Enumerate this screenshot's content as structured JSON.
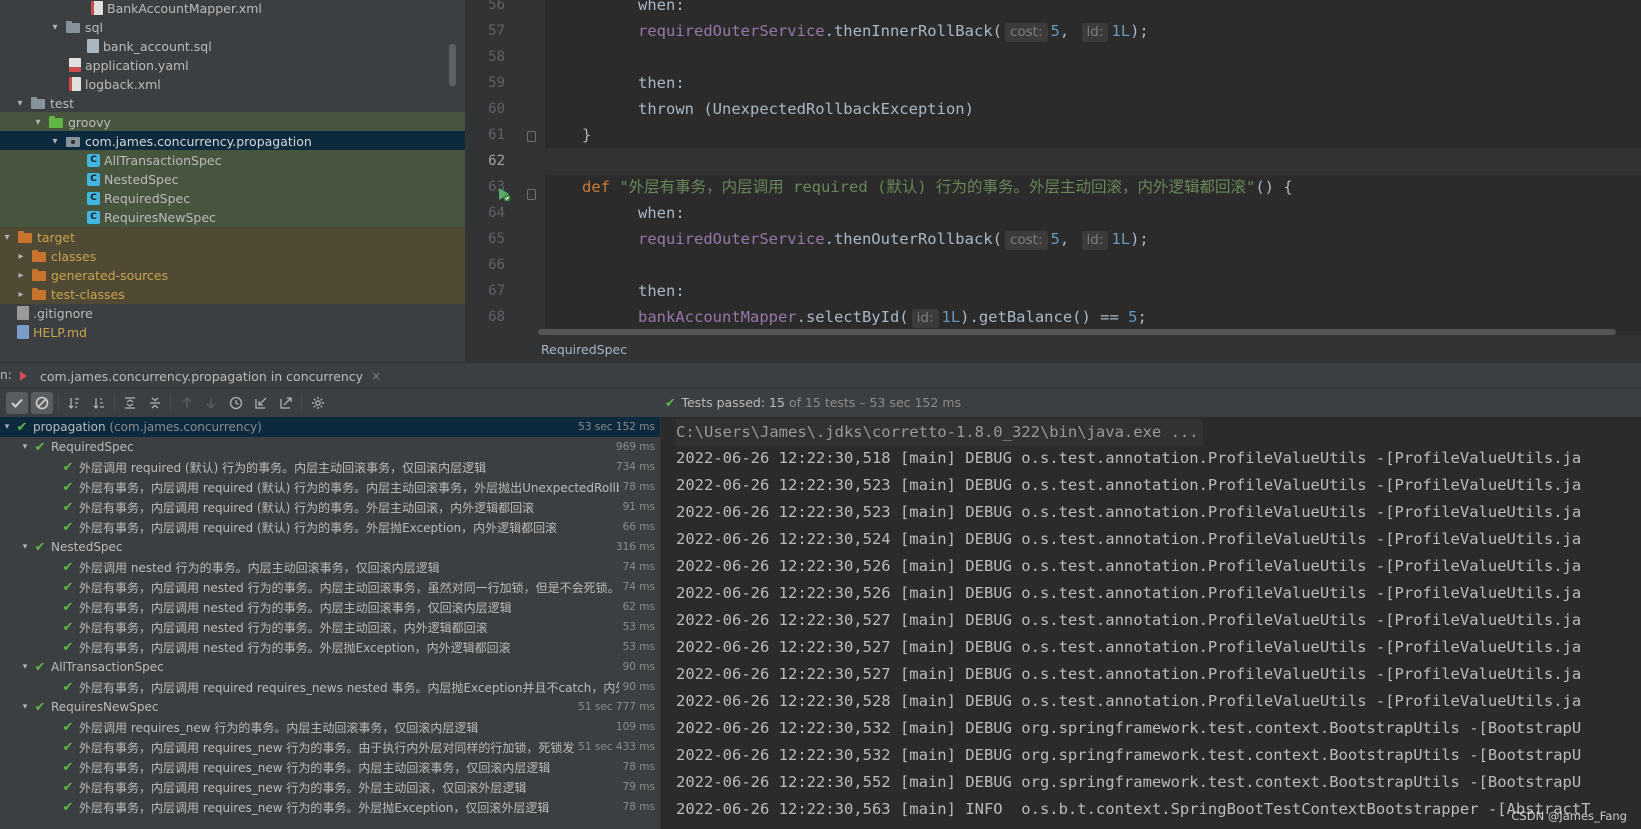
{
  "project_tree": {
    "items": [
      {
        "label": "BankAccountMapper.xml",
        "icon": "xml-file-icon",
        "state": ""
      },
      {
        "label": "sql",
        "icon": "folder-icon",
        "state": "expanded"
      },
      {
        "label": "bank_account.sql",
        "icon": "sql-file-icon",
        "state": ""
      },
      {
        "label": "application.yaml",
        "icon": "yaml-file-icon",
        "state": ""
      },
      {
        "label": "logback.xml",
        "icon": "xml-file-icon",
        "state": ""
      },
      {
        "label": "test",
        "icon": "folder-icon",
        "state": "expanded"
      },
      {
        "label": "groovy",
        "icon": "test-root-folder-icon",
        "state": "expanded"
      },
      {
        "label": "com.james.concurrency.propagation",
        "icon": "package-icon",
        "state": "expanded"
      },
      {
        "label": "AllTransactionSpec",
        "icon": "class-icon",
        "state": ""
      },
      {
        "label": "NestedSpec",
        "icon": "class-icon",
        "state": ""
      },
      {
        "label": "RequiredSpec",
        "icon": "class-icon",
        "state": ""
      },
      {
        "label": "RequiresNewSpec",
        "icon": "class-icon",
        "state": ""
      },
      {
        "label": "target",
        "icon": "excluded-folder-icon",
        "state": "expanded"
      },
      {
        "label": "classes",
        "icon": "excluded-folder-icon",
        "state": "collapsed"
      },
      {
        "label": "generated-sources",
        "icon": "excluded-folder-icon",
        "state": "collapsed"
      },
      {
        "label": "test-classes",
        "icon": "excluded-folder-icon",
        "state": "collapsed"
      },
      {
        "label": ".gitignore",
        "icon": "gitignore-file-icon",
        "state": ""
      },
      {
        "label": "HELP.md",
        "icon": "markdown-file-icon",
        "state": ""
      }
    ]
  },
  "editor": {
    "line_numbers": [
      "56",
      "57",
      "58",
      "59",
      "60",
      "61",
      "62",
      "63",
      "64",
      "65",
      "66",
      "67",
      "68"
    ],
    "current_line": "62",
    "lines": {
      "l56": {
        "when": "when:"
      },
      "l57": {
        "field": "requiredOuterService",
        "method": ".thenInnerRollBack(",
        "hint1": "cost:",
        "arg1": "5",
        "comma": ",",
        "hint2": "id:",
        "arg2": "1L",
        "close": ");"
      },
      "l59": {
        "then": "then:"
      },
      "l60": {
        "text": "thrown (UnexpectedRollbackException)"
      },
      "l61": {
        "brace": "}"
      },
      "l63": {
        "kw": "def",
        "str": "\"外层有事务，内层调用 required (默认) 行为的事务。外层主动回滚，内外逻辑都回滚\"",
        "rest": "() {"
      },
      "l64": {
        "when": "when:"
      },
      "l65": {
        "field": "requiredOuterService",
        "method": ".thenOuterRollback(",
        "hint1": "cost:",
        "arg1": "5",
        "comma": ",",
        "hint2": "id:",
        "arg2": "1L",
        "close": ");"
      },
      "l67": {
        "then": "then:"
      },
      "l68": {
        "field": "bankAccountMapper",
        "method": ".selectById(",
        "hint1": "id:",
        "arg1": "1L",
        "rest": ").getBalance() == ",
        "num": "5",
        "semi": ";"
      }
    },
    "breadcrumb": "RequiredSpec"
  },
  "run_panel": {
    "prefix": "n:",
    "tab_label": "com.james.concurrency.propagation in concurrency",
    "tab_close": "×",
    "status": {
      "check": "✔",
      "label": "Tests passed:",
      "count": "15",
      "suffix": "of 15 tests – 53 sec 152 ms"
    }
  },
  "test_tree": {
    "root": {
      "name": "propagation",
      "pkg": "(com.james.concurrency)",
      "time": "53 sec 152 ms"
    },
    "suites": [
      {
        "name": "RequiredSpec",
        "time": "969 ms",
        "tests": [
          {
            "name": "外层调用 required (默认) 行为的事务。内层主动回滚事务，仅回滚内层逻辑",
            "time": "734 ms"
          },
          {
            "name": "外层有事务，内层调用 required (默认) 行为的事务。内层主动回滚事务，外层抛出UnexpectedRollbackException",
            "time": "78 ms"
          },
          {
            "name": "外层有事务，内层调用 required (默认) 行为的事务。外层主动回滚，内外逻辑都回滚",
            "time": "91 ms"
          },
          {
            "name": "外层有事务，内层调用 required (默认) 行为的事务。外层抛Exception，内外逻辑都回滚",
            "time": "66 ms"
          }
        ]
      },
      {
        "name": "NestedSpec",
        "time": "316 ms",
        "tests": [
          {
            "name": "外层调用 nested 行为的事务。内层主动回滚事务，仅回滚内层逻辑",
            "time": "74 ms"
          },
          {
            "name": "外层有事务，内层调用 nested 行为的事务。内层主动回滚事务，虽然对同一行加锁，但是不会死锁。",
            "time": "74 ms"
          },
          {
            "name": "外层有事务，内层调用 nested 行为的事务。内层主动回滚事务，仅回滚内层逻辑",
            "time": "62 ms"
          },
          {
            "name": "外层有事务，内层调用 nested 行为的事务。外层主动回滚，内外逻辑都回滚",
            "time": "53 ms"
          },
          {
            "name": "外层有事务，内层调用 nested 行为的事务。外层抛Exception，内外逻辑都回滚",
            "time": "53 ms"
          }
        ]
      },
      {
        "name": "AllTransactionSpec",
        "time": "90 ms",
        "tests": [
          {
            "name": "外层有事务，内层调用 required requires_news nested 事务。内层抛Exception并且不catch，内外逻辑都回滚",
            "time": "90 ms"
          }
        ]
      },
      {
        "name": "RequiresNewSpec",
        "time": "51 sec 777 ms",
        "tests": [
          {
            "name": "外层调用 requires_new 行为的事务。内层主动回滚事务，仅回滚内层逻辑",
            "time": "109 ms"
          },
          {
            "name": "外层有事务，内层调用 requires_new 行为的事务。由于执行内外层对同样的行加锁，死锁发生",
            "time": "51 sec 433 ms"
          },
          {
            "name": "外层有事务，内层调用 requires_new 行为的事务。内层主动回滚事务，仅回滚内层逻辑",
            "time": "78 ms"
          },
          {
            "name": "外层有事务，内层调用 requires_new  行为的事务。外层主动回滚，仅回滚外层逻辑",
            "time": "79 ms"
          },
          {
            "name": "外层有事务，内层调用 requires_new  行为的事务。外层抛Exception，仅回滚外层逻辑",
            "time": "78 ms"
          }
        ]
      }
    ]
  },
  "console": {
    "lines": [
      "C:\\Users\\James\\.jdks\\corretto-1.8.0_322\\bin\\java.exe ...",
      "2022-06-26 12:22:30,518 [main] DEBUG o.s.test.annotation.ProfileValueUtils -[ProfileValueUtils.ja",
      "2022-06-26 12:22:30,523 [main] DEBUG o.s.test.annotation.ProfileValueUtils -[ProfileValueUtils.ja",
      "2022-06-26 12:22:30,523 [main] DEBUG o.s.test.annotation.ProfileValueUtils -[ProfileValueUtils.ja",
      "2022-06-26 12:22:30,524 [main] DEBUG o.s.test.annotation.ProfileValueUtils -[ProfileValueUtils.ja",
      "2022-06-26 12:22:30,526 [main] DEBUG o.s.test.annotation.ProfileValueUtils -[ProfileValueUtils.ja",
      "2022-06-26 12:22:30,526 [main] DEBUG o.s.test.annotation.ProfileValueUtils -[ProfileValueUtils.ja",
      "2022-06-26 12:22:30,527 [main] DEBUG o.s.test.annotation.ProfileValueUtils -[ProfileValueUtils.ja",
      "2022-06-26 12:22:30,527 [main] DEBUG o.s.test.annotation.ProfileValueUtils -[ProfileValueUtils.ja",
      "2022-06-26 12:22:30,527 [main] DEBUG o.s.test.annotation.ProfileValueUtils -[ProfileValueUtils.ja",
      "2022-06-26 12:22:30,528 [main] DEBUG o.s.test.annotation.ProfileValueUtils -[ProfileValueUtils.ja",
      "2022-06-26 12:22:30,532 [main] DEBUG org.springframework.test.context.BootstrapUtils -[BootstrapU",
      "2022-06-26 12:22:30,532 [main] DEBUG org.springframework.test.context.BootstrapUtils -[BootstrapU",
      "2022-06-26 12:22:30,552 [main] DEBUG org.springframework.test.context.BootstrapUtils -[BootstrapU",
      "2022-06-26 12:22:30,563 [main] INFO  o.s.b.t.context.SpringBootTestContextBootstrapper -[AbstractT"
    ],
    "watermark": "CSDN @James_Fang"
  }
}
